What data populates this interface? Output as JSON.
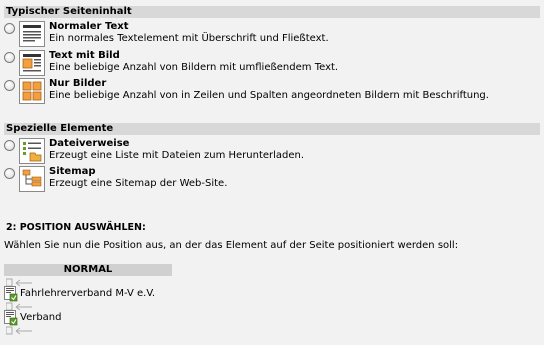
{
  "sections": {
    "typical": {
      "header": "Typischer Seiteninhalt",
      "items": [
        {
          "title": "Normaler Text",
          "desc": "Ein normales Textelement mit Überschrift und Fließtext.",
          "icon": "text-icon"
        },
        {
          "title": "Text mit Bild",
          "desc": "Eine beliebige Anzahl von Bildern mit umfließendem Text.",
          "icon": "text-with-image-icon"
        },
        {
          "title": "Nur Bilder",
          "desc": "Eine beliebige Anzahl von in Zeilen und Spalten angeordneten Bildern mit Beschriftung.",
          "icon": "images-only-icon"
        }
      ]
    },
    "special": {
      "header": "Spezielle Elemente",
      "items": [
        {
          "title": "Dateiverweise",
          "desc": "Erzeugt eine Liste mit Dateien zum Herunterladen.",
          "icon": "file-links-icon"
        },
        {
          "title": "Sitemap",
          "desc": "Erzeugt eine Sitemap der Web-Site.",
          "icon": "sitemap-icon"
        }
      ]
    }
  },
  "position": {
    "step_title": "2: POSITION AUSWÄHLEN:",
    "step_desc": "Wählen Sie nun die Position aus, an der das Element auf der Seite positioniert werden soll:",
    "column_header": "NORMAL",
    "elements": [
      {
        "label": "Fahrlehrerverband M-V e.V.",
        "icon": "page-content-icon"
      },
      {
        "label": "Verband",
        "icon": "page-content-icon"
      }
    ]
  }
}
